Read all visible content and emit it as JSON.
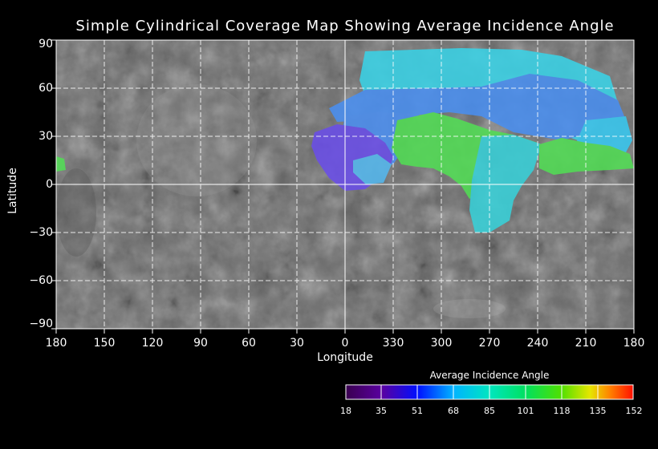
{
  "title": "Simple Cylindrical Coverage Map Showing Average Incidence Angle",
  "x_axis": {
    "label": "Longitude",
    "ticks": [
      "180",
      "150",
      "120",
      "90",
      "60",
      "30",
      "0",
      "330",
      "300",
      "270",
      "240",
      "210",
      "180"
    ]
  },
  "y_axis": {
    "label": "Latitude",
    "ticks": [
      "90",
      "60",
      "30",
      "0",
      "−30",
      "−60",
      "−90"
    ]
  },
  "colorbar": {
    "title": "Average Incidence Angle",
    "ticks": [
      "18",
      "35",
      "51",
      "68",
      "85",
      "101",
      "118",
      "135",
      "152"
    ],
    "colors": [
      "#5a00a0",
      "#0010ff",
      "#00b4ff",
      "#00e6c0",
      "#00e060",
      "#50e000",
      "#e6e600",
      "#ff8000",
      "#ff1000"
    ]
  },
  "colors": {
    "background": "#000000",
    "basemap": "#6e6e6e",
    "grid": "#ffffff",
    "coverage_purple": "#6a4ee8",
    "coverage_blue": "#4a9bf0",
    "coverage_cyan": "#35d6e0",
    "coverage_green": "#55e04a"
  }
}
